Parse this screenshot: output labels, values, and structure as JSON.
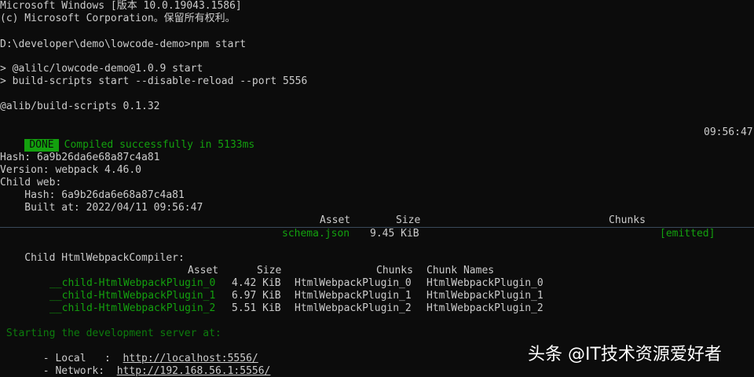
{
  "header": {
    "line1": "Microsoft Windows [版本 10.0.19043.1586]",
    "line2": "(c) Microsoft Corporation。保留所有权利。"
  },
  "prompt": "D:\\developer\\demo\\lowcode-demo>npm start",
  "script_lines": [
    "> @alilc/lowcode-demo@1.0.9 start",
    "> build-scripts start --disable-reload --port 5556"
  ],
  "build_scripts_version": "@alib/build-scripts 0.1.32",
  "status": {
    "badge": "DONE",
    "message": "Compiled successfully in 5133ms",
    "time": "09:56:47"
  },
  "summary": {
    "hash": "Hash: 6a9b26da6e68a87c4a81",
    "version": "Version: webpack 4.46.0",
    "child": "Child web:",
    "child_hash": "    Hash: 6a9b26da6e68a87c4a81",
    "built_at": "    Built at: 2022/04/11 09:56:47"
  },
  "asset_table": {
    "headers": {
      "asset": "Asset",
      "size": "Size",
      "chunks": "Chunks"
    },
    "row": {
      "asset": "schema.json",
      "size": "9.45 KiB",
      "status": "[emitted]"
    }
  },
  "compiler": {
    "title": "    Child HtmlWebpackCompiler:",
    "headers": {
      "asset": "Asset",
      "size": "Size",
      "chunks": "Chunks",
      "chunk_names": "Chunk Names"
    },
    "rows": [
      {
        "asset": "__child-HtmlWebpackPlugin_0",
        "size": "4.42 KiB",
        "chunks": "HtmlWebpackPlugin_0",
        "chunk_names": "HtmlWebpackPlugin_0"
      },
      {
        "asset": "__child-HtmlWebpackPlugin_1",
        "size": "6.97 KiB",
        "chunks": "HtmlWebpackPlugin_1",
        "chunk_names": "HtmlWebpackPlugin_1"
      },
      {
        "asset": "__child-HtmlWebpackPlugin_2",
        "size": "5.51 KiB",
        "chunks": "HtmlWebpackPlugin_2",
        "chunk_names": "HtmlWebpackPlugin_2"
      }
    ]
  },
  "server": {
    "starting": " Starting the development server at:",
    "local_label": "   - Local   :  ",
    "local_url": "http://localhost:5556/",
    "network_label": "   - Network:  ",
    "network_url": "http://192.168.56.1:5556/"
  },
  "watermark": "头条 @IT技术资源爱好者",
  "colors": {
    "background": "#0c0c0c",
    "foreground": "#cccccc",
    "accent_green": "#13a10e"
  }
}
